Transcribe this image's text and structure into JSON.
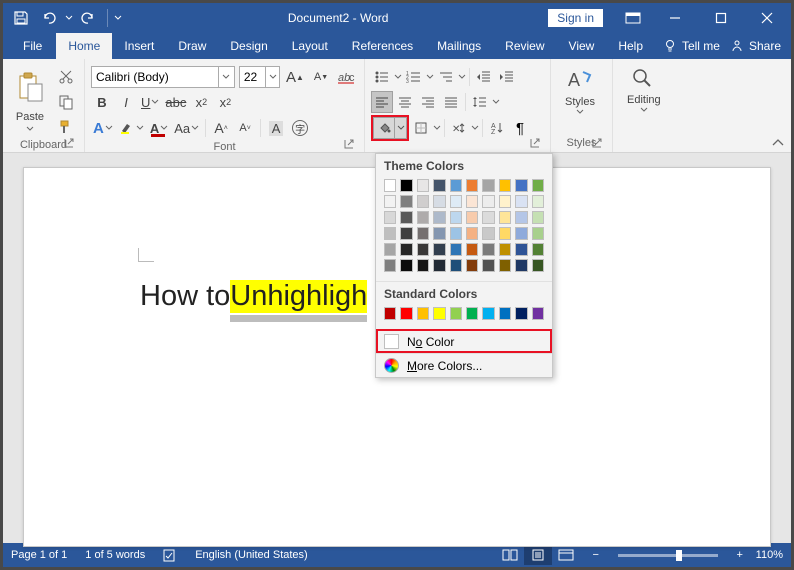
{
  "title": {
    "doc": "Document2",
    "app": "Word"
  },
  "signin": "Sign in",
  "tabs": {
    "file": "File",
    "home": "Home",
    "insert": "Insert",
    "draw": "Draw",
    "design": "Design",
    "layout": "Layout",
    "references": "References",
    "mailings": "Mailings",
    "review": "Review",
    "view": "View",
    "help": "Help",
    "tellme": "Tell me",
    "share": "Share"
  },
  "groups": {
    "clipboard": "Clipboard",
    "font": "Font",
    "styles": "Styles",
    "editing": "Editing",
    "paste": "Paste",
    "styles_btn": "Styles",
    "editing_btn": "Editing"
  },
  "font": {
    "name": "Calibri (Body)",
    "size": "22"
  },
  "colorpopup": {
    "theme": "Theme Colors",
    "standard": "Standard Colors",
    "nocolor_pre": "N",
    "nocolor_u": "o",
    "nocolor_post": " Color",
    "more_pre": "",
    "more_u": "M",
    "more_post": "ore Colors...",
    "theme_top": [
      "#ffffff",
      "#000000",
      "#e7e6e6",
      "#44546a",
      "#5b9bd5",
      "#ed7d31",
      "#a5a5a5",
      "#ffc000",
      "#4472c4",
      "#70ad47"
    ],
    "theme_shades": [
      [
        "#f2f2f2",
        "#7f7f7f",
        "#d0cece",
        "#d6dce4",
        "#deebf6",
        "#fbe5d5",
        "#ededed",
        "#fff2cc",
        "#d9e2f3",
        "#e2efd9"
      ],
      [
        "#d8d8d8",
        "#595959",
        "#aeabab",
        "#adb9ca",
        "#bdd7ee",
        "#f7cbac",
        "#dbdbdb",
        "#fee599",
        "#b4c6e7",
        "#c5e0b3"
      ],
      [
        "#bfbfbf",
        "#3f3f3f",
        "#757070",
        "#8496b0",
        "#9cc3e5",
        "#f4b183",
        "#c9c9c9",
        "#ffd965",
        "#8eaadb",
        "#a8d08d"
      ],
      [
        "#a5a5a5",
        "#262626",
        "#3a3838",
        "#323f4f",
        "#2e75b5",
        "#c55a11",
        "#7b7b7b",
        "#bf9000",
        "#2f5496",
        "#538135"
      ],
      [
        "#7f7f7f",
        "#0c0c0c",
        "#171616",
        "#222a35",
        "#1e4e79",
        "#833c0b",
        "#525252",
        "#7f6000",
        "#1f3864",
        "#375623"
      ]
    ],
    "standard_row": [
      "#c00000",
      "#ff0000",
      "#ffc000",
      "#ffff00",
      "#92d050",
      "#00b050",
      "#00b0f0",
      "#0070c0",
      "#002060",
      "#7030a0"
    ]
  },
  "document": {
    "plain": "How to ",
    "highlighted": "Unhighligh"
  },
  "status": {
    "page": "Page 1 of 1",
    "words": "1 of 5 words",
    "lang": "English (United States)",
    "zoom": "110%"
  }
}
